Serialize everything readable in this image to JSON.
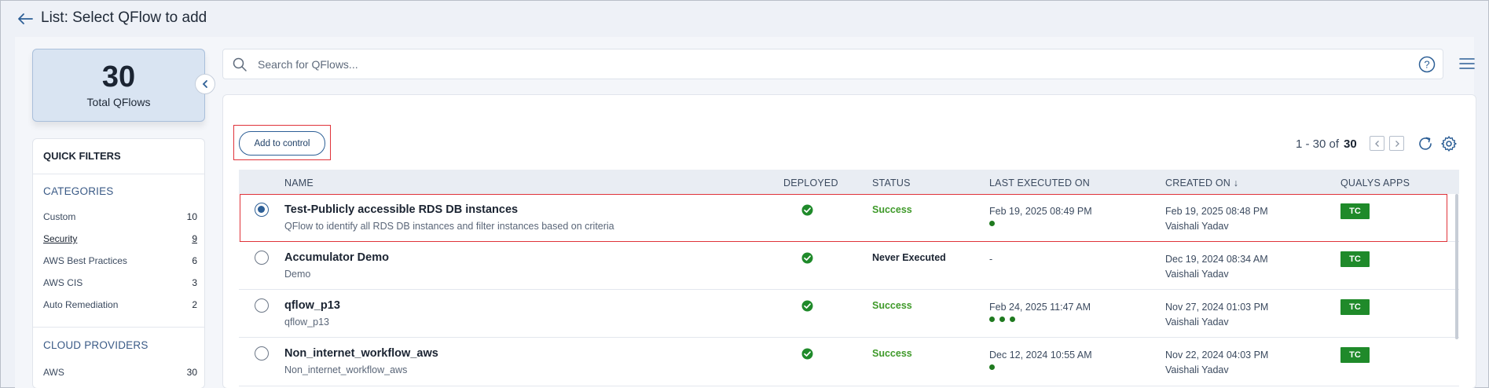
{
  "header": {
    "title": "List: Select QFlow to add"
  },
  "summary": {
    "count": "30",
    "label": "Total QFlows"
  },
  "filters": {
    "title": "QUICK FILTERS",
    "categories_title": "CATEGORIES",
    "categories": [
      {
        "label": "Custom",
        "count": "10"
      },
      {
        "label": "Security",
        "count": "9",
        "active": true
      },
      {
        "label": "AWS Best Practices",
        "count": "6"
      },
      {
        "label": "AWS CIS",
        "count": "3"
      },
      {
        "label": "Auto Remediation",
        "count": "2"
      }
    ],
    "providers_title": "CLOUD PROVIDERS",
    "providers": [
      {
        "label": "AWS",
        "count": "30"
      }
    ]
  },
  "search": {
    "placeholder": "Search for QFlows..."
  },
  "toolbar": {
    "add_label": "Add to control",
    "pager_range": "1 - 30 of",
    "pager_total": "30"
  },
  "table": {
    "columns": [
      "NAME",
      "DEPLOYED",
      "STATUS",
      "LAST EXECUTED ON",
      "CREATED ON ↓",
      "QUALYS APPS"
    ],
    "rows": [
      {
        "name": "Test-Publicly accessible RDS DB instances",
        "description": "QFlow to identify all RDS DB instances and filter instances based on criteria",
        "selected": true,
        "deployed": true,
        "status": "Success",
        "status_type": "success",
        "last_executed": "Feb 19, 2025 08:49 PM",
        "dots": 1,
        "created_on": "Feb 19, 2025 08:48 PM",
        "created_by": "Vaishali Yadav",
        "app": "TC"
      },
      {
        "name": "Accumulator Demo",
        "description": "Demo",
        "selected": false,
        "deployed": true,
        "status": "Never Executed",
        "status_type": "never",
        "last_executed": "-",
        "dots": 0,
        "created_on": "Dec 19, 2024 08:34 AM",
        "created_by": "Vaishali Yadav",
        "app": "TC"
      },
      {
        "name": "qflow_p13",
        "description": "qflow_p13",
        "selected": false,
        "deployed": true,
        "status": "Success",
        "status_type": "success",
        "last_executed": "Feb 24, 2025 11:47 AM",
        "dots": 3,
        "created_on": "Nov 27, 2024 01:03 PM",
        "created_by": "Vaishali Yadav",
        "app": "TC"
      },
      {
        "name": "Non_internet_workflow_aws",
        "description": "Non_internet_workflow_aws",
        "selected": false,
        "deployed": true,
        "status": "Success",
        "status_type": "success",
        "last_executed": "Dec 12, 2024 10:55 AM",
        "dots": 1,
        "created_on": "Nov 22, 2024 04:03 PM",
        "created_by": "Vaishali Yadav",
        "app": "TC"
      }
    ]
  },
  "colors": {
    "accent": "#2d5f96",
    "success": "#3f9a2a",
    "badge": "#1f8a2a",
    "highlight": "#e0333a"
  }
}
